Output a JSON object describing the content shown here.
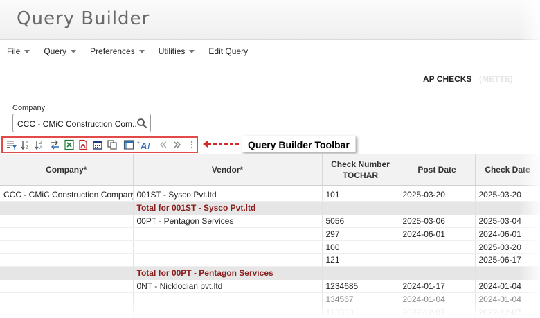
{
  "app": {
    "title": "Query Builder"
  },
  "menu": [
    {
      "label": "File",
      "has_caret": true
    },
    {
      "label": "Query",
      "has_caret": true
    },
    {
      "label": "Preferences",
      "has_caret": true
    },
    {
      "label": "Utilities",
      "has_caret": true
    },
    {
      "label": "Edit Query",
      "has_caret": false
    }
  ],
  "report": {
    "title": "AP CHECKS",
    "subtitle": "(METTE)"
  },
  "filter": {
    "company_label": "Company",
    "company_value": "CCC - CMiC Construction Com...",
    "search_icon": "search-icon"
  },
  "toolbar": {
    "buttons": [
      "filter-icon",
      "sort-ascending-icon",
      "sort-descending-icon",
      "swap-columns-icon",
      "export-excel-icon",
      "export-pdf-icon",
      "calendar-icon",
      "copy-icon",
      "layout-icon",
      "text-format-icon",
      "first-page-icon",
      "next-page-icon",
      "more-options-icon"
    ],
    "callout": "Query Builder Toolbar"
  },
  "table": {
    "headers": [
      "Company*",
      "Vendor*",
      "Check Number",
      "TOCHAR",
      "Post Date",
      "Check Date"
    ],
    "rows": [
      {
        "type": "data",
        "company": "CCC - CMiC Construction Company",
        "vendor": "001ST - Sysco Pvt.ltd",
        "check": "101",
        "post": "2025-03-20",
        "checkdate": "2025-03-20"
      },
      {
        "type": "total",
        "label": "Total for 001ST - Sysco Pvt.ltd"
      },
      {
        "type": "data",
        "company": "",
        "vendor": "00PT - Pentagon Services",
        "check": "5056",
        "post": "2025-03-06",
        "checkdate": "2025-03-04"
      },
      {
        "type": "data",
        "company": "",
        "vendor": "",
        "check": "297",
        "post": "2024-06-01",
        "checkdate": "2024-06-01"
      },
      {
        "type": "data",
        "company": "",
        "vendor": "",
        "check": "100",
        "post": "",
        "checkdate": "2025-03-20"
      },
      {
        "type": "data",
        "company": "",
        "vendor": "",
        "check": "121",
        "post": "",
        "checkdate": "2025-06-17"
      },
      {
        "type": "total",
        "label": "Total for 00PT - Pentagon Services"
      },
      {
        "type": "data",
        "company": "",
        "vendor": "0NT - Nicklodian pvt.ltd",
        "check": "1234685",
        "post": "2024-01-17",
        "checkdate": "2024-01-04"
      },
      {
        "type": "data",
        "company": "",
        "vendor": "",
        "check": "134567",
        "post": "2024-01-04",
        "checkdate": "2024-01-04"
      },
      {
        "type": "data",
        "company": "",
        "vendor": "",
        "check": "123333",
        "post": "2022-12-07",
        "checkdate": "2022-12-07"
      }
    ]
  }
}
